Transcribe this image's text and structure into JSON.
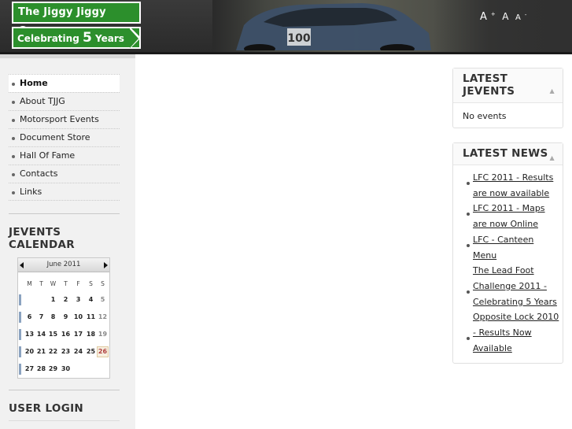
{
  "header": {
    "logo_title": "The Jiggy Jiggy Group",
    "logo_subtitle_pre": "Celebrating ",
    "logo_subtitle_num": "5",
    "logo_subtitle_post": " Years",
    "font_tools": {
      "large": "A",
      "normal": "A",
      "small": "A",
      "large_sup": "+",
      "small_sup": "-"
    },
    "car_number": "100"
  },
  "menu": {
    "items": [
      {
        "label": "Home"
      },
      {
        "label": "About TJJG"
      },
      {
        "label": "Motorsport Events"
      },
      {
        "label": "Document Store"
      },
      {
        "label": "Hall Of Fame"
      },
      {
        "label": "Contacts"
      },
      {
        "label": "Links"
      }
    ]
  },
  "calendar": {
    "heading": "JEVENTS CALENDAR",
    "month": "June 2011",
    "dow": [
      "M",
      "T",
      "W",
      "T",
      "F",
      "S",
      "S"
    ],
    "weeks": [
      [
        "",
        "",
        "1",
        "2",
        "3",
        "4",
        "5"
      ],
      [
        "6",
        "7",
        "8",
        "9",
        "10",
        "11",
        "12"
      ],
      [
        "13",
        "14",
        "15",
        "16",
        "17",
        "18",
        "19"
      ],
      [
        "20",
        "21",
        "22",
        "23",
        "24",
        "25",
        "26"
      ],
      [
        "27",
        "28",
        "29",
        "30",
        "",
        "",
        ""
      ]
    ],
    "today": "26"
  },
  "login": {
    "heading": "USER LOGIN"
  },
  "jevents_module": {
    "title": "LATEST JEVENTS",
    "body": "No events"
  },
  "news_module": {
    "title": "LATEST NEWS",
    "lines": [
      {
        "text": "LFC 2011 - Results",
        "bullet": true
      },
      {
        "text": "are now available",
        "bullet": false
      },
      {
        "text": "LFC 2011 - Maps",
        "bullet": true
      },
      {
        "text": "are now Online",
        "bullet": false
      },
      {
        "text": "LFC - Canteen",
        "bullet": true
      },
      {
        "text": "Menu",
        "bullet": false
      },
      {
        "text": "The Lead Foot",
        "bullet": false
      },
      {
        "text": "Challenge 2011 -",
        "bullet": true
      },
      {
        "text": "Celebrating 5 Years",
        "bullet": false
      },
      {
        "text": "Opposite Lock 2010",
        "bullet": false
      },
      {
        "text": "- Results Now",
        "bullet": true
      },
      {
        "text": "Available",
        "bullet": false
      }
    ]
  }
}
